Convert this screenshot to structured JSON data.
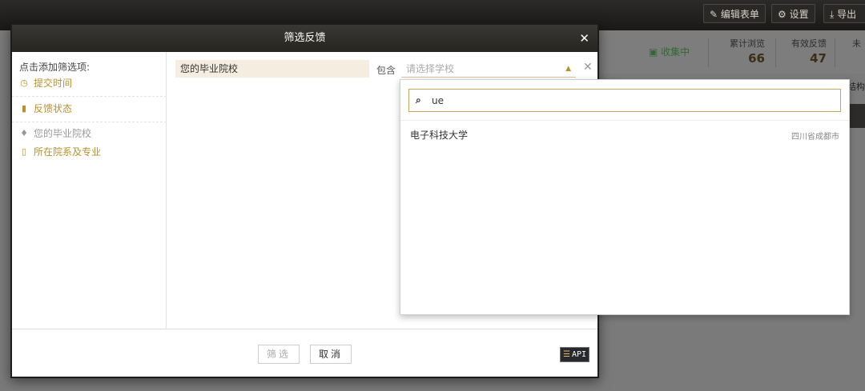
{
  "toolbar": {
    "edit_form": "编辑表单",
    "settings": "设置",
    "export": "导出"
  },
  "stats": {
    "collecting": "收集中",
    "total_views_label": "累计浏览",
    "total_views": "66",
    "valid_feedback_label": "有效反馈",
    "valid_feedback": "47",
    "third_label": "未",
    "fragment": "结构"
  },
  "modal": {
    "title": "筛选反馈",
    "close": "✕",
    "left": {
      "title": "点击添加筛选项:",
      "items": [
        {
          "label": "提交时间",
          "icon": "clock-icon"
        },
        {
          "label": "反馈状态",
          "icon": "bookmark-icon"
        },
        {
          "label": "您的毕业院校",
          "icon": "graduation-cap-icon"
        },
        {
          "label": "所在院系及专业",
          "icon": "book-icon"
        }
      ]
    },
    "condition": {
      "field": "您的毕业院校",
      "operator": "包含",
      "placeholder": "请选择学校",
      "remove": "✕"
    },
    "footer": {
      "filter": "筛选",
      "cancel": "取消",
      "api": "API"
    }
  },
  "dropdown": {
    "query": "ue",
    "options": [
      {
        "name": "电子科技大学",
        "location": "四川省成都市"
      }
    ]
  }
}
